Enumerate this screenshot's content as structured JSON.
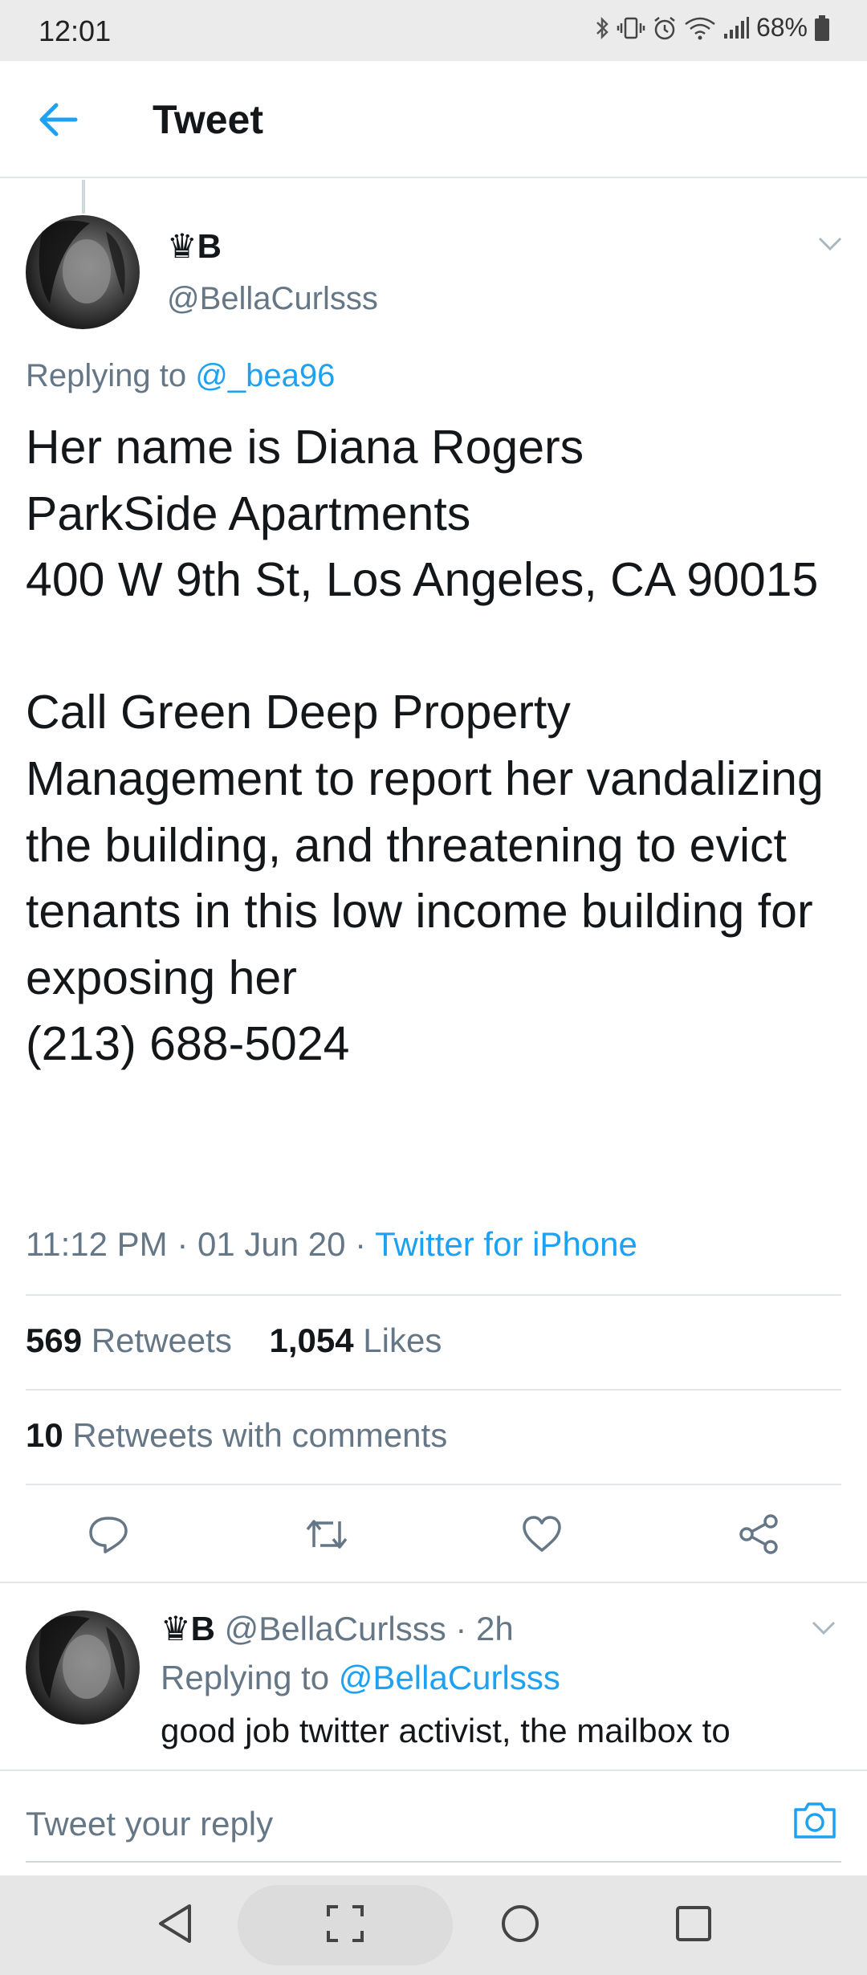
{
  "status_bar": {
    "time": "12:01",
    "battery": "68%",
    "icons": [
      "bluetooth-icon",
      "vibrate-icon",
      "alarm-icon",
      "wifi-icon",
      "signal-icon",
      "battery-icon"
    ]
  },
  "header": {
    "title": "Tweet",
    "back_icon": "arrow-left-icon"
  },
  "tweet": {
    "author_name": "♛B",
    "author_handle": "@BellaCurlsss",
    "replying_label": "Replying to",
    "replying_to": "@_bea96",
    "text": "Her name is Diana Rogers\nParkSide Apartments\n400 W 9th St, Los Angeles, CA 90015\n\nCall Green Deep Property Management to report her vandalizing the building, and threatening to evict tenants in this low income building for exposing her\n(213) 688-5024",
    "time": "11:12 PM",
    "sep1": " · ",
    "date": "01 Jun 20",
    "sep2": " · ",
    "source": "Twitter for iPhone",
    "retweets_count": "569",
    "retweets_label": "Retweets",
    "likes_count": "1,054",
    "likes_label": "Likes",
    "quote_count": "10",
    "quote_label": "Retweets with comments"
  },
  "actions": [
    "reply-icon",
    "retweet-icon",
    "like-icon",
    "share-icon"
  ],
  "reply": {
    "author_name": "♛B",
    "author_handle": "@BellaCurlsss",
    "time": "· 2h",
    "replying_label": "Replying to",
    "replying_to": "@BellaCurlsss",
    "text": "good job twitter activist, the mailbox to"
  },
  "compose": {
    "placeholder": "Tweet your reply"
  },
  "colors": {
    "link": "#1da1f2",
    "secondary_text": "#657786",
    "primary_text": "#14171a",
    "divider": "#e1e8ed"
  }
}
